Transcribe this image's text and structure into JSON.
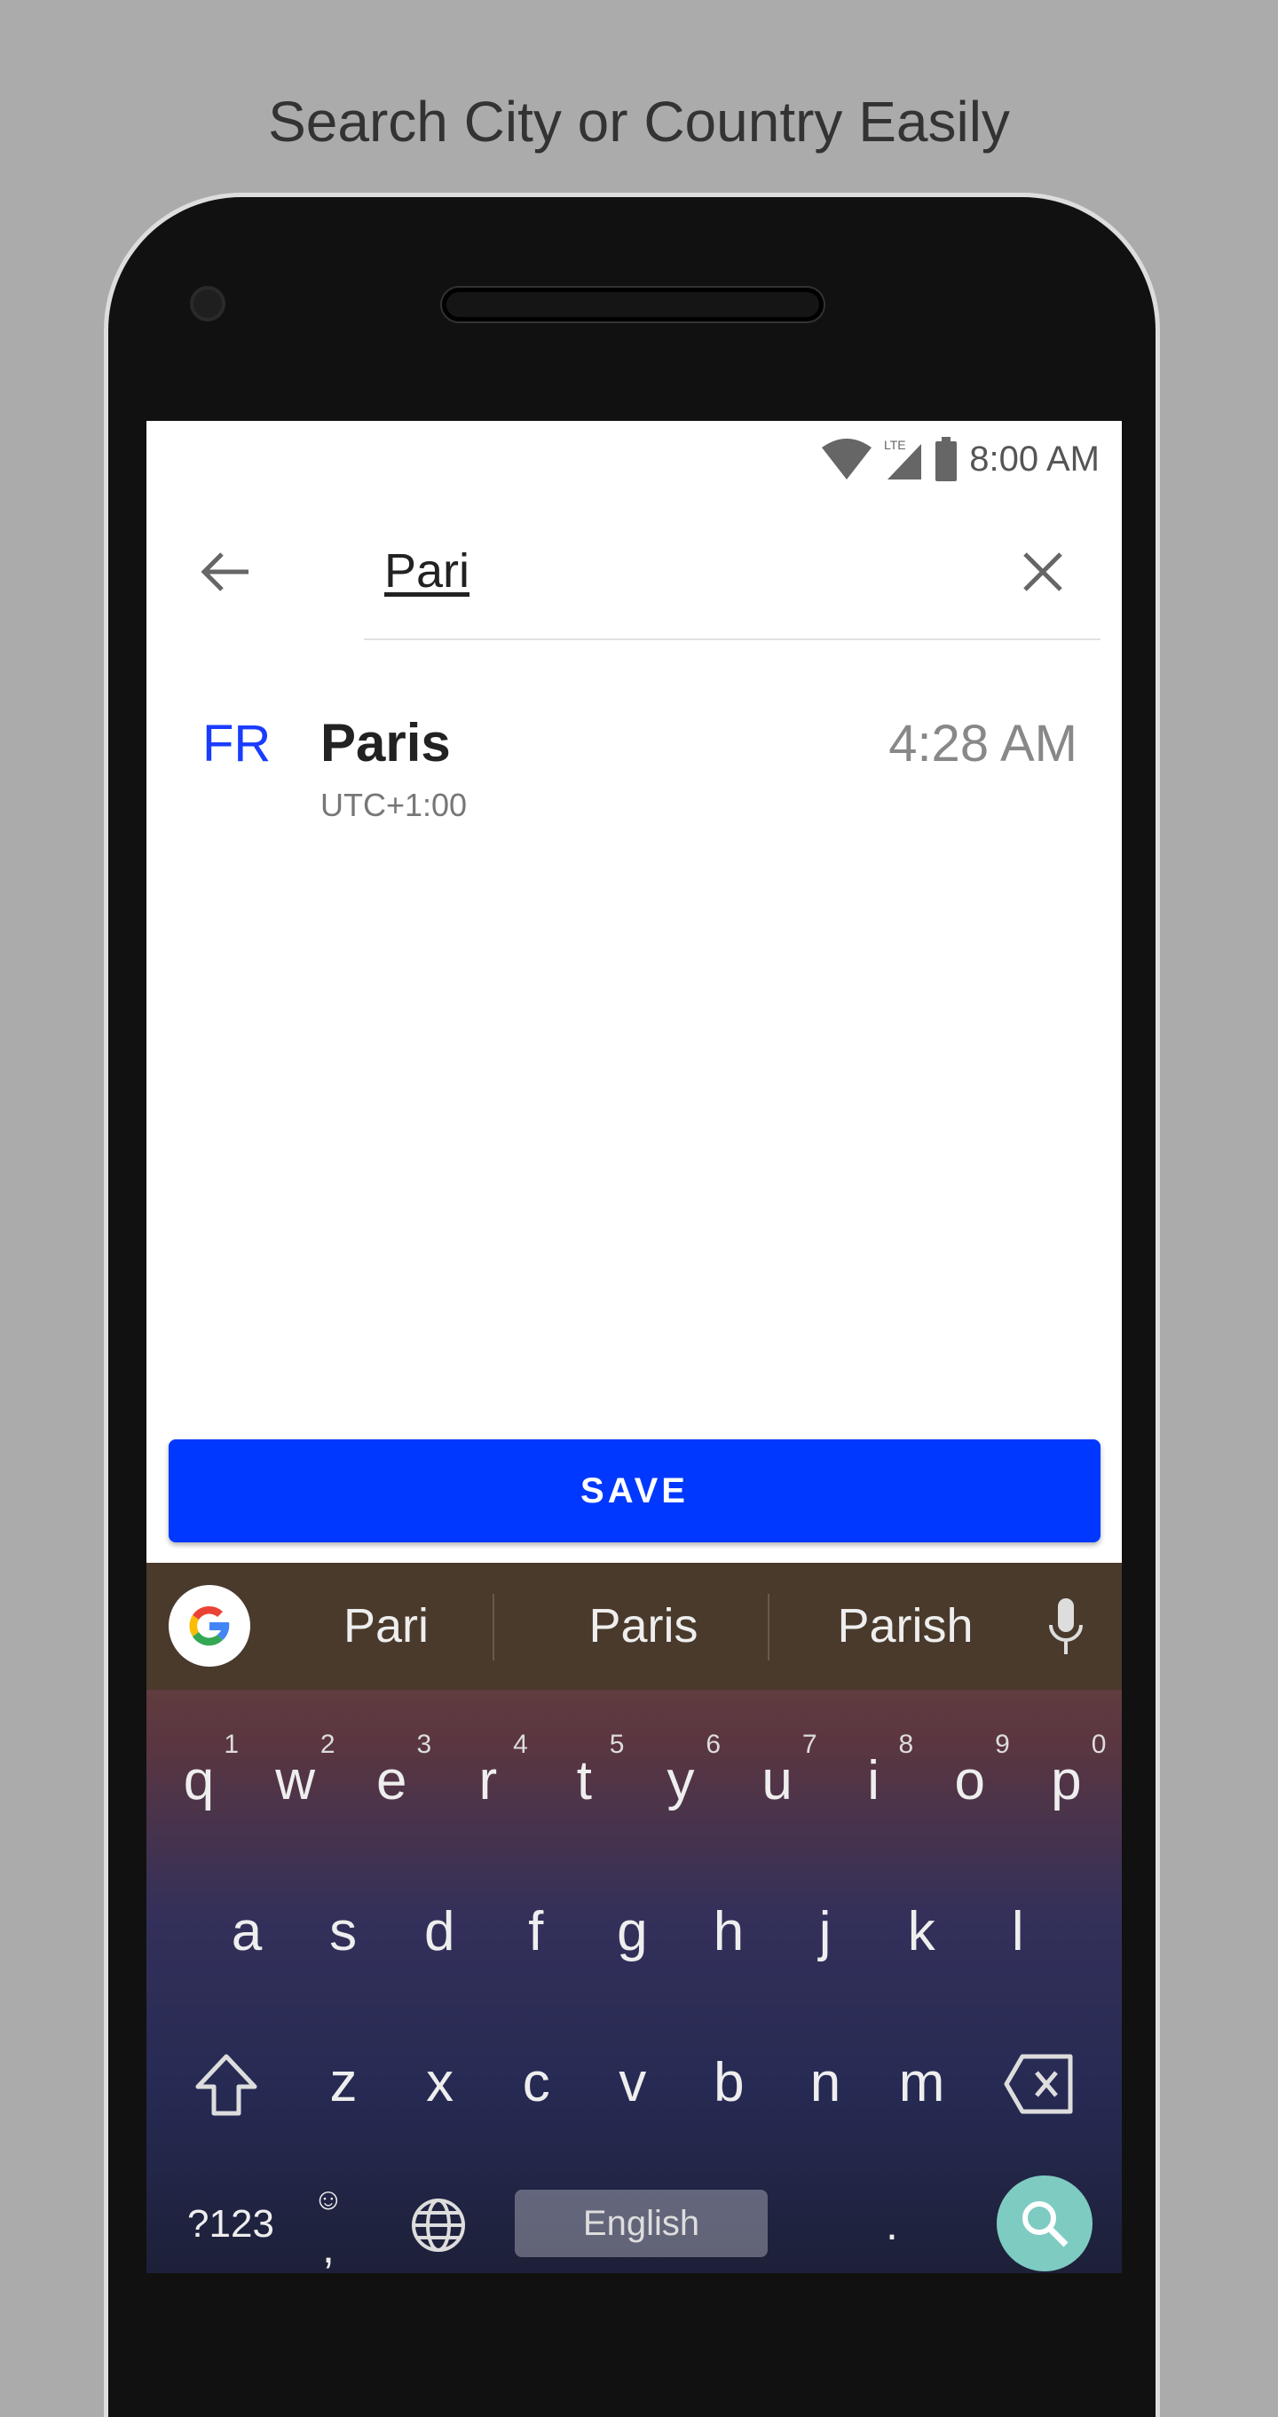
{
  "headline": "Search City or Country Easily",
  "status_bar": {
    "time": "8:00 AM",
    "network": "LTE",
    "icons": [
      "wifi-icon",
      "cell-signal-icon",
      "battery-icon"
    ]
  },
  "search": {
    "query": "Pari",
    "back_icon": "arrow-left-icon",
    "clear_icon": "close-icon"
  },
  "results": [
    {
      "country_code": "FR",
      "city": "Paris",
      "utc_offset": "UTC+1:00",
      "local_time": "4:28 AM"
    }
  ],
  "save_label": "SAVE",
  "colors": {
    "accent": "#0038ff",
    "country_code": "#1a3cff",
    "search_key": "#7ecbc2"
  },
  "keyboard": {
    "suggestions": [
      "Pari",
      "Paris",
      "Parish"
    ],
    "row1": [
      {
        "k": "q",
        "n": "1"
      },
      {
        "k": "w",
        "n": "2"
      },
      {
        "k": "e",
        "n": "3"
      },
      {
        "k": "r",
        "n": "4"
      },
      {
        "k": "t",
        "n": "5"
      },
      {
        "k": "y",
        "n": "6"
      },
      {
        "k": "u",
        "n": "7"
      },
      {
        "k": "i",
        "n": "8"
      },
      {
        "k": "o",
        "n": "9"
      },
      {
        "k": "p",
        "n": "0"
      }
    ],
    "row2": [
      "a",
      "s",
      "d",
      "f",
      "g",
      "h",
      "j",
      "k",
      "l"
    ],
    "row3": [
      "z",
      "x",
      "c",
      "v",
      "b",
      "n",
      "m"
    ],
    "symbols": "?123",
    "comma": ",",
    "period": ".",
    "space_label": "English"
  }
}
